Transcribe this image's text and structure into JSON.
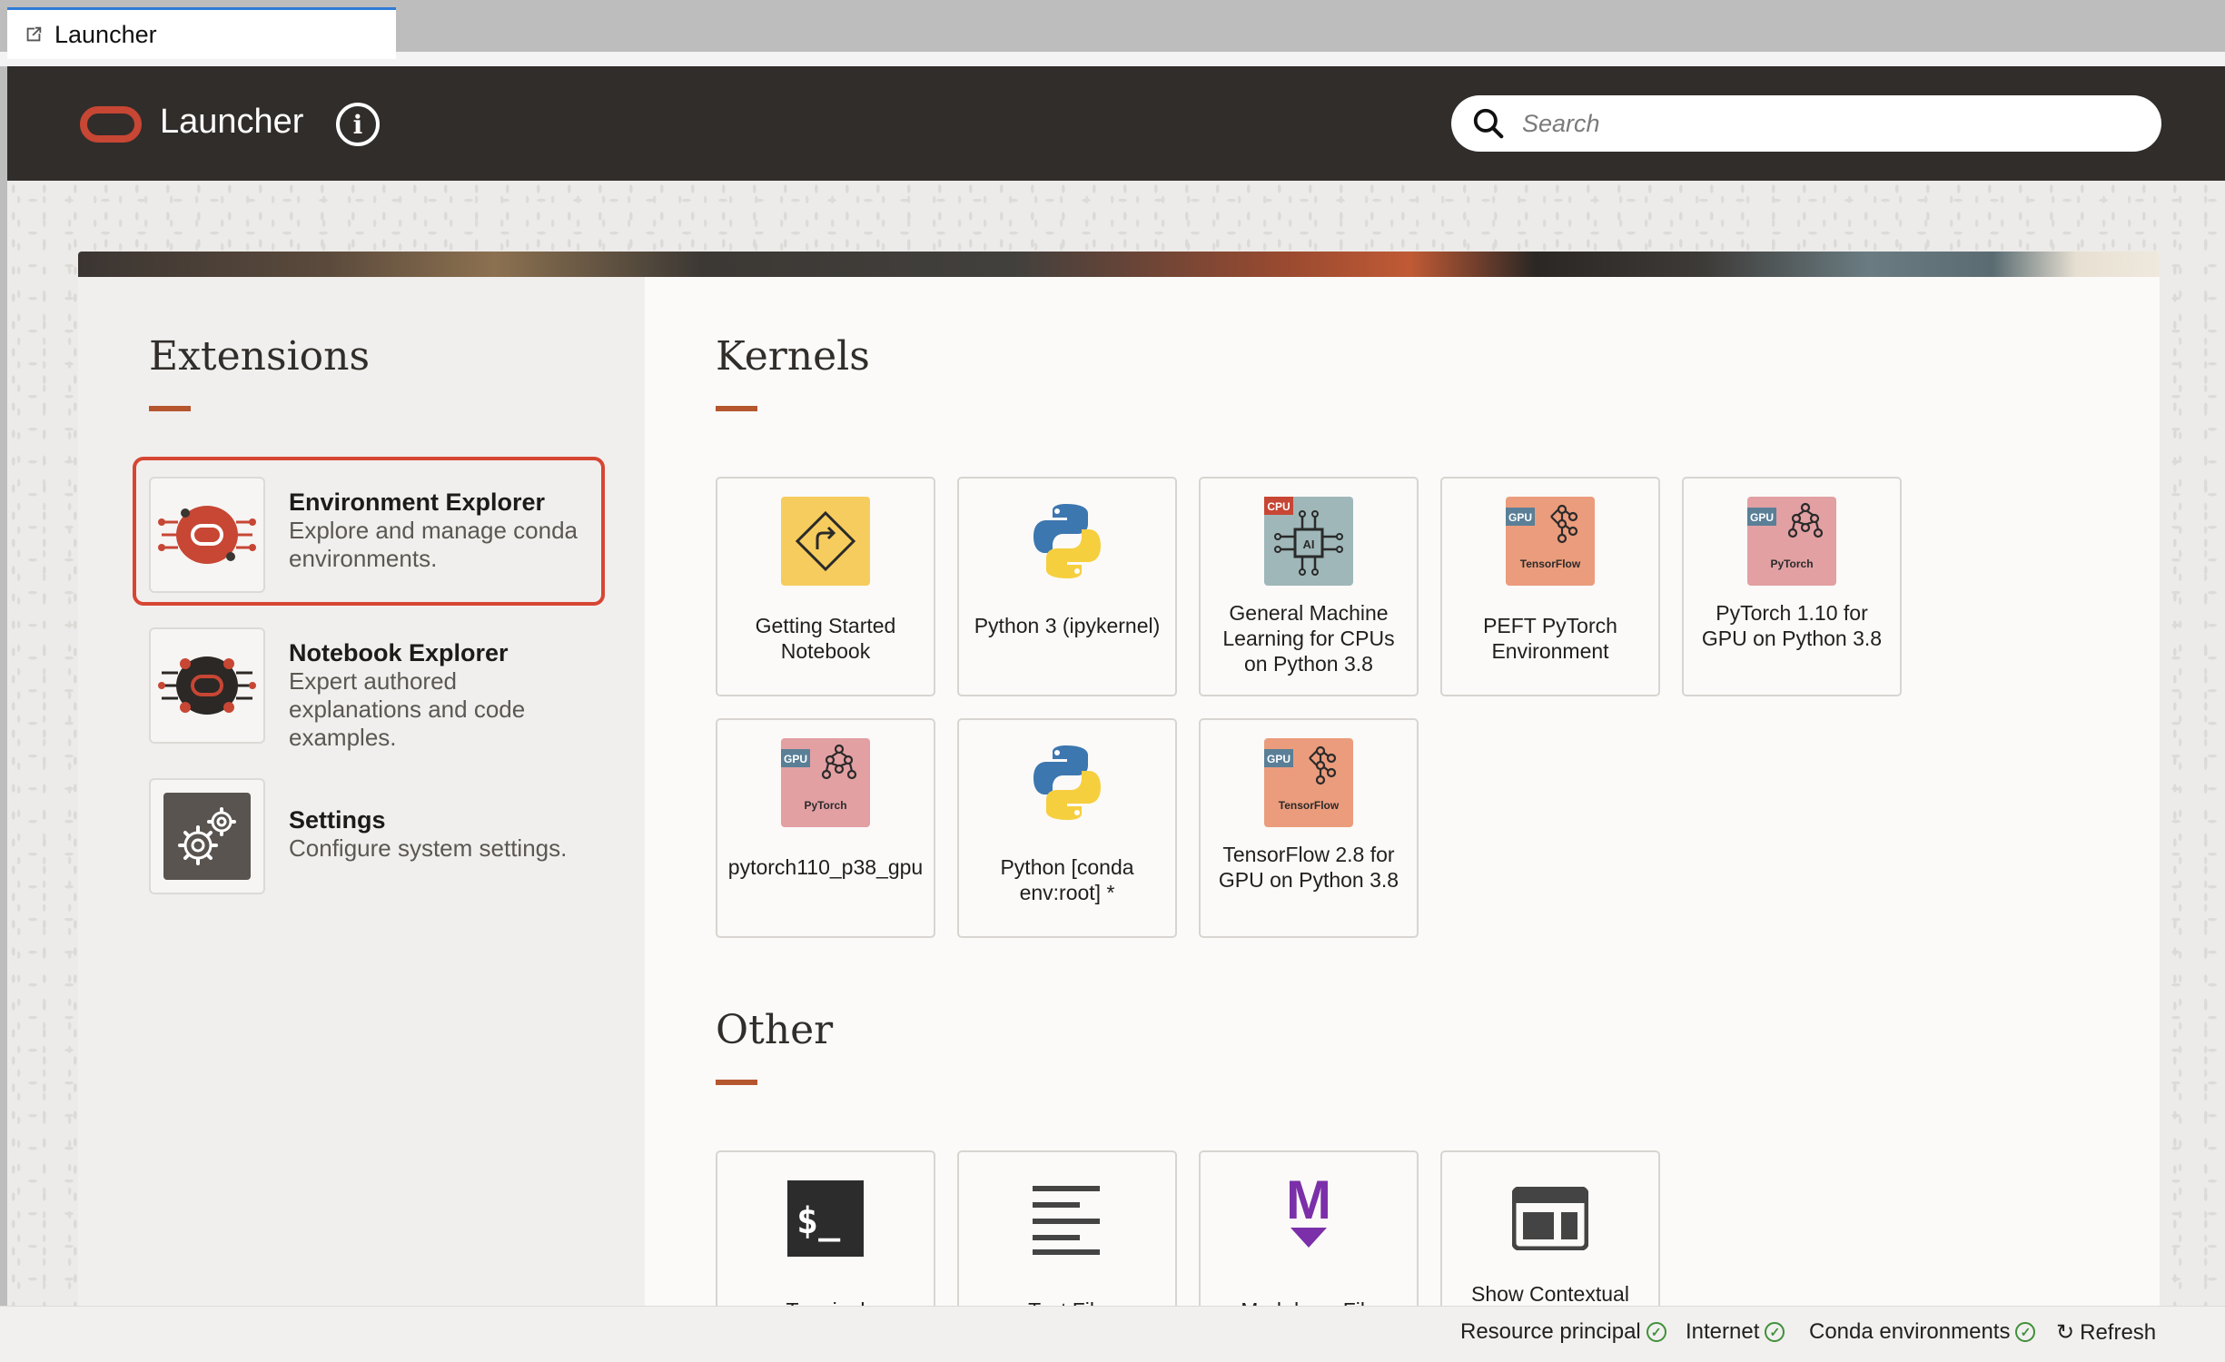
{
  "tab": {
    "label": "Launcher"
  },
  "header": {
    "title": "Launcher",
    "search_placeholder": "Search"
  },
  "extensions": {
    "title": "Extensions",
    "items": [
      {
        "name": "Environment Explorer",
        "desc": "Explore and manage conda environments."
      },
      {
        "name": "Notebook Explorer",
        "desc": "Expert authored explanations and code examples."
      },
      {
        "name": "Settings",
        "desc": "Configure system settings."
      }
    ]
  },
  "kernels": {
    "title": "Kernels",
    "items": [
      {
        "label": "Getting Started Notebook"
      },
      {
        "label": "Python 3 (ipykernel)"
      },
      {
        "label": "General Machine Learning for CPUs on Python 3.8",
        "chip": "CPU"
      },
      {
        "label": "PEFT PyTorch Environment",
        "chip": "GPU",
        "framework": "TensorFlow"
      },
      {
        "label": "PyTorch 1.10 for GPU on Python 3.8",
        "chip": "GPU",
        "framework": "PyTorch"
      },
      {
        "label": "pytorch110_p38_gpu",
        "chip": "GPU",
        "framework": "PyTorch"
      },
      {
        "label": "Python [conda env:root] *"
      },
      {
        "label": "TensorFlow 2.8 for GPU on Python 3.8",
        "chip": "GPU",
        "framework": "TensorFlow"
      }
    ]
  },
  "other": {
    "title": "Other",
    "items": [
      {
        "label": "Terminal"
      },
      {
        "label": "Text File"
      },
      {
        "label": "Markdown File"
      },
      {
        "label": "Show Contextual Help"
      }
    ]
  },
  "status": {
    "resource_principal": "Resource principal",
    "internet": "Internet",
    "conda": "Conda environments",
    "refresh": "Refresh"
  },
  "colors": {
    "accent": "#c74634",
    "header_bg": "#312d2a",
    "highlight": "#d64633",
    "ok_green": "#3f8f3a"
  }
}
